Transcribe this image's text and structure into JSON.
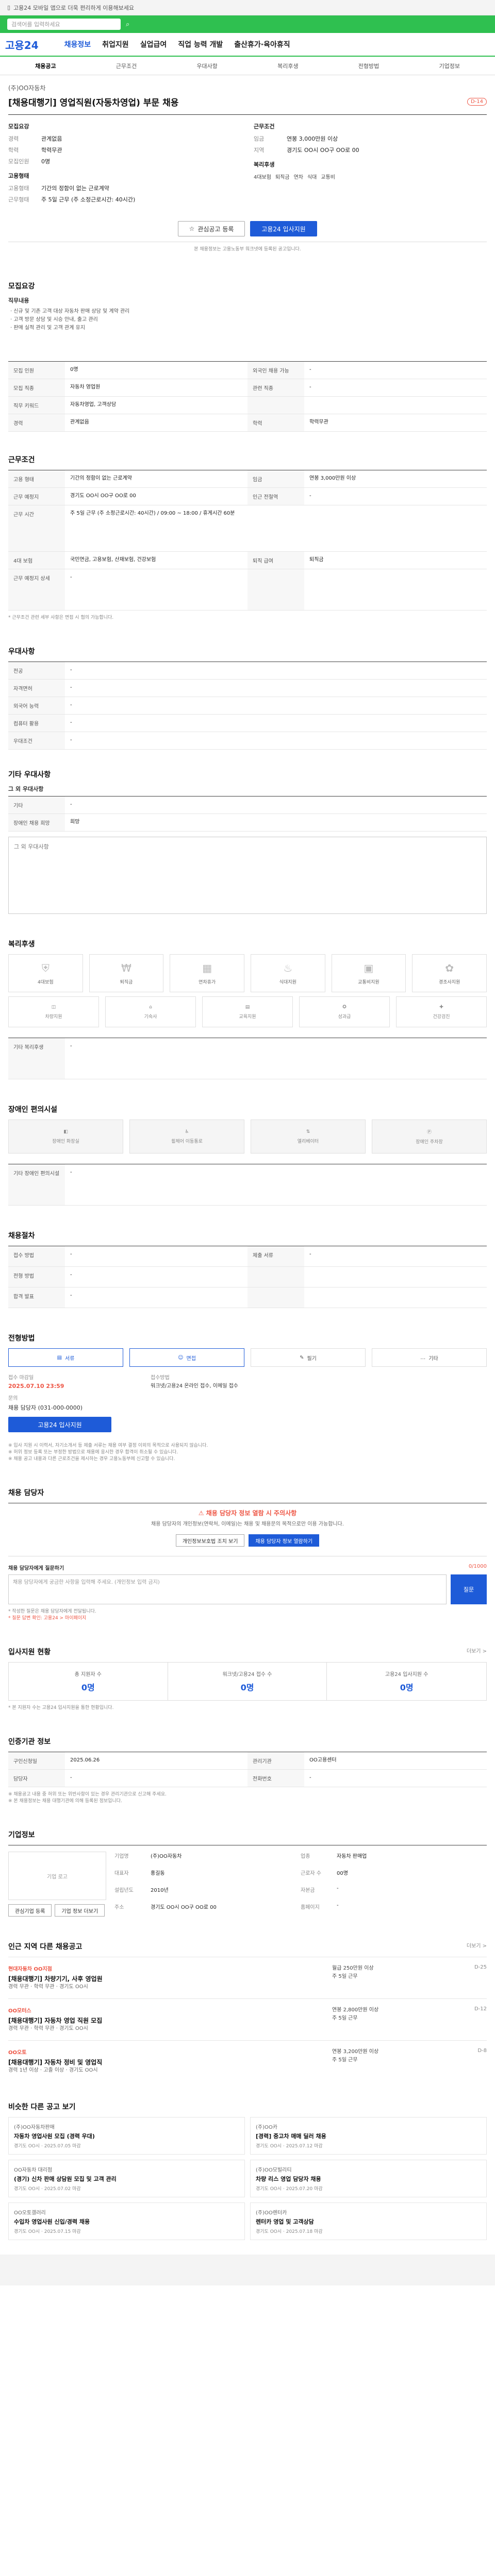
{
  "topstrip": {
    "text": "고용24 모바일 앱으로 더욱 편리하게 이용해보세요"
  },
  "search": {
    "placeholder": "검색어를 입력하세요"
  },
  "header": {
    "logo": "고용24",
    "nav": [
      "채용정보",
      "취업지원",
      "실업급여",
      "직업 능력 개발",
      "출산휴가·육아휴직"
    ]
  },
  "tabs": [
    "채용공고",
    "근무조건",
    "우대사항",
    "복리후생",
    "전형방법",
    "기업정보"
  ],
  "post": {
    "company": "(주)OO자동차",
    "title": "[채용대행기] 영업직원(자동차영업) 부문 채용",
    "badge": "D-14",
    "summary_left_title": "모집요강",
    "summary_right_title": "근무조건",
    "left": [
      {
        "k": "경력",
        "v": "관계없음"
      },
      {
        "k": "학력",
        "v": "학력무관"
      },
      {
        "k": "모집인원",
        "v": "0명"
      }
    ],
    "left2_title": "고용형태",
    "left2": [
      {
        "k": "고용형태",
        "v": "기간의 정함이 없는 근로계약"
      },
      {
        "k": "근무형태",
        "v": "주 5일 근무 (주 소정근로시간: 40시간)"
      }
    ],
    "right": [
      {
        "k": "임금",
        "v": "연봉 3,000만원 이상"
      },
      {
        "k": "지역",
        "v": "경기도 OO시 OO구 OO로 00"
      }
    ],
    "right2_title": "복리후생",
    "chips": [
      "4대보험",
      "퇴직금",
      "연차",
      "식대",
      "교통비"
    ]
  },
  "actions": {
    "scrap": "관심공고 등록",
    "apply": "고용24 입사지원"
  },
  "notice": "본 채용정보는 고용노동부 워크넷에 등록된 공고입니다.",
  "sec1": {
    "title": "모집요강",
    "sub": "직무내용",
    "bullets": [
      "· 신규 및 기존 고객 대상 자동차 판매 상담 및 계약 관리",
      "· 고객 방문 상담 및 시승 안내, 출고 관리",
      "· 판매 실적 관리 및 고객 관계 유지"
    ],
    "rows": [
      [
        "모집 인원",
        "0명",
        "외국인 채용 가능",
        "-"
      ],
      [
        "모집 직종",
        "자동차 영업원",
        "관련 직종",
        "-"
      ],
      [
        "직무 키워드",
        "자동차영업, 고객상담",
        "",
        ""
      ],
      [
        "경력",
        "관계없음",
        "학력",
        "학력무관"
      ]
    ]
  },
  "sec2": {
    "title": "근무조건",
    "rows": [
      [
        "고용 형태",
        "기간의 정함이 없는 근로계약",
        "임금",
        "연봉 3,000만원 이상"
      ],
      [
        "근무 예정지",
        "경기도 OO시 OO구 OO로 00",
        "인근 전철역",
        "-"
      ]
    ],
    "hours_k": "근무 시간",
    "hours_v": "주 5일 근무 (주 소정근로시간: 40시간) / 09:00 ~ 18:00 / 휴게시간 60분",
    "rows2": [
      [
        "4대 보험",
        "국민연금, 고용보험, 산재보험, 건강보험",
        "퇴직 급여",
        "퇴직금"
      ],
      [
        "근무 예정지 상세",
        "-",
        "",
        ""
      ]
    ],
    "footnote": "* 근무조건 관련 세부 사항은 면접 시 협의 가능합니다."
  },
  "sec3": {
    "title": "우대사항",
    "rows": [
      [
        "전공",
        "-"
      ],
      [
        "자격면허",
        "-"
      ],
      [
        "외국어 능력",
        "-"
      ],
      [
        "컴퓨터 활용",
        "-"
      ],
      [
        "우대조건",
        "-"
      ]
    ]
  },
  "sec4": {
    "title": "기타 우대사항",
    "sub": "그 외 우대사항",
    "rows": [
      [
        "기타",
        "-"
      ],
      [
        "장애인 채용 희망",
        "희망"
      ]
    ],
    "box": "그 외 우대사항"
  },
  "sec5": {
    "title": "복리후생",
    "icons": [
      {
        "icon": "insurance-icon",
        "glyph": "⛨",
        "label": "4대보험"
      },
      {
        "icon": "money-icon",
        "glyph": "₩",
        "label": "퇴직금"
      },
      {
        "icon": "calendar-icon",
        "glyph": "▦",
        "label": "연차휴가"
      },
      {
        "icon": "meal-icon",
        "glyph": "♨",
        "label": "식대지원"
      },
      {
        "icon": "bus-icon",
        "glyph": "▣",
        "label": "교통비지원"
      },
      {
        "icon": "gift-icon",
        "glyph": "✿",
        "label": "경조사지원"
      }
    ],
    "icons2": [
      {
        "icon": "car-icon",
        "glyph": "◫",
        "label": "차량지원"
      },
      {
        "icon": "house-icon",
        "glyph": "⌂",
        "label": "기숙사"
      },
      {
        "icon": "book-icon",
        "glyph": "▤",
        "label": "교육지원"
      },
      {
        "icon": "medal-icon",
        "glyph": "✪",
        "label": "성과급"
      },
      {
        "icon": "health-icon",
        "glyph": "✚",
        "label": "건강검진"
      }
    ],
    "etc_k": "기타 복리후생",
    "etc_v": "-"
  },
  "sec6": {
    "title": "장애인 편의시설",
    "icons": [
      "장애인 화장실",
      "휠체어 이동통로",
      "엘리베이터",
      "장애인 주차장"
    ],
    "etc_k": "기타 장애인 편의시설",
    "etc_v": "-"
  },
  "sec7": {
    "title": "채용절차",
    "rows": [
      [
        "접수 방법",
        "-",
        "제출 서류",
        "-"
      ],
      [
        "전형 방법",
        "-",
        "",
        ""
      ],
      [
        "합격 발표",
        "-",
        "",
        ""
      ]
    ]
  },
  "sec8": {
    "title": "전형방법",
    "methods": [
      "서류",
      "면접",
      "필기",
      "기타"
    ],
    "deadline_k": "접수 마감일",
    "deadline_v": "2025.07.10 23:59",
    "apply_k": "접수방법",
    "apply_v": "워크넷/고용24 온라인 접수, 이메일 접수",
    "phone_k": "문의",
    "phone_v": "채용 담당자 (031-000-0000)",
    "apply_btn": "고용24 입사지원",
    "notes": [
      "※ 입사 지원 시 이력서, 자기소개서 등 제출 서류는 채용 여부 결정 이외의 목적으로 사용되지 않습니다.",
      "※ 허위 정보 등록 또는 부정한 방법으로 채용에 응시한 경우 합격이 취소될 수 있습니다.",
      "※ 채용 공고 내용과 다른 근로조건을 제시하는 경우 고용노동부에 신고할 수 있습니다."
    ]
  },
  "sec9": {
    "title": "채용 담당자",
    "red": "채용 담당자 정보 열람 시 주의사항",
    "desc": "채용 담당자의 개인정보(연락처, 이메일)는 채용 및 채용문의 목적으로만 이용 가능합니다.",
    "btn1": "개인정보보호법 조치 보기",
    "btn2": "채용 담당자 정보 열람하기",
    "inq_title": "채용 담당자에게 질문하기",
    "inq_counter": "0/1000",
    "inq_placeholder": "채용 담당자에게 궁금한 사항을 입력해 주세요. (개인정보 입력 금지)",
    "inq_btn": "질문",
    "inq_notes": [
      "* 작성한 질문은 채용 담당자에게 전달됩니다.",
      "* 질문 답변 확인: 고용24 > 마이페이지"
    ]
  },
  "sec10": {
    "title": "입사지원 현황",
    "stats": [
      {
        "k": "총 지원자 수",
        "v": "0명"
      },
      {
        "k": "워크넷/고용24 접수 수",
        "v": "0명"
      },
      {
        "k": "고용24 입사지원 수",
        "v": "0명"
      }
    ],
    "note": "* 본 지원자 수는 고용24 입사지원을 통한 현황입니다.",
    "more": "더보기 >"
  },
  "sec11": {
    "title": "인증기관 정보",
    "rows": [
      [
        "구인신청일",
        "2025.06.26",
        "관리기관",
        "OO고용센터"
      ],
      [
        "담당자",
        "-",
        "전화번호",
        "-"
      ]
    ],
    "notes": [
      "※ 채용공고 내용 중 허위 또는 위반사항이 있는 경우 관리기관으로 신고해 주세요.",
      "※ 본 채용정보는 채용 대행기관에 의해 등록된 정보입니다."
    ]
  },
  "sec12": {
    "title": "기업정보",
    "logo": "기업 로고",
    "btn1": "관심기업 등록",
    "btn2": "기업 정보 더보기",
    "info": [
      [
        "기업명",
        "(주)OO자동차",
        "업종",
        "자동차 판매업"
      ],
      [
        "대표자",
        "홍길동",
        "근로자 수",
        "00명"
      ],
      [
        "설립년도",
        "2010년",
        "자본금",
        "-"
      ],
      [
        "주소",
        "경기도 OO시 OO구 OO로 00",
        "홈페이지",
        "-"
      ]
    ]
  },
  "sec13": {
    "title": "인근 지역 다른 채용공고",
    "more": "더보기 >",
    "items": [
      {
        "co": "현대자동차 OO지점",
        "title": "[채용대행기] 차량기기, 사후 영업원",
        "meta": [
          "경력 무관",
          "학력 무관",
          "경기도 OO시"
        ],
        "pay": [
          "월급 250만원 이상",
          "주 5일 근무"
        ],
        "right": "D-25"
      },
      {
        "co": "OO모터스",
        "title": "[채용대행기] 자동차 영업 직원 모집",
        "meta": [
          "경력 무관",
          "학력 무관",
          "경기도 OO시"
        ],
        "pay": [
          "연봉 2,800만원 이상",
          "주 5일 근무"
        ],
        "right": "D-12"
      },
      {
        "co": "OO오토",
        "title": "[채용대행기] 자동차 정비 및 영업직",
        "meta": [
          "경력 1년 이상",
          "고졸 이상",
          "경기도 OO시"
        ],
        "pay": [
          "연봉 3,200만원 이상",
          "주 5일 근무"
        ],
        "right": "D-8"
      }
    ]
  },
  "sec14": {
    "title": "비슷한 다른 공고 보기",
    "cards": [
      {
        "s1": "(주)OO자동차판매",
        "s2": "자동차 영업사원 모집 (경력 우대)",
        "s3": "경기도 OO시 · 2025.07.05 마감"
      },
      {
        "s1": "(주)OO카",
        "s2": "[경력] 중고차 매매 딜러 채용",
        "s3": "경기도 OO시 · 2025.07.12 마감"
      },
      {
        "s1": "OO자동차 대리점",
        "s2": "(경기) 신차 판매 상담원 모집 및 고객 관리",
        "s3": "경기도 OO시 · 2025.07.02 마감"
      },
      {
        "s1": "(주)OO모빌리티",
        "s2": "차량 리스 영업 담당자 채용",
        "s3": "경기도 OO시 · 2025.07.20 마감"
      },
      {
        "s1": "OO오토갤러리",
        "s2": "수입차 영업사원 신입/경력 채용",
        "s3": "경기도 OO시 · 2025.07.15 마감"
      },
      {
        "s1": "(주)OO렌터카",
        "s2": "렌터카 영업 및 고객상담",
        "s3": "경기도 OO시 · 2025.07.18 마감"
      }
    ]
  }
}
